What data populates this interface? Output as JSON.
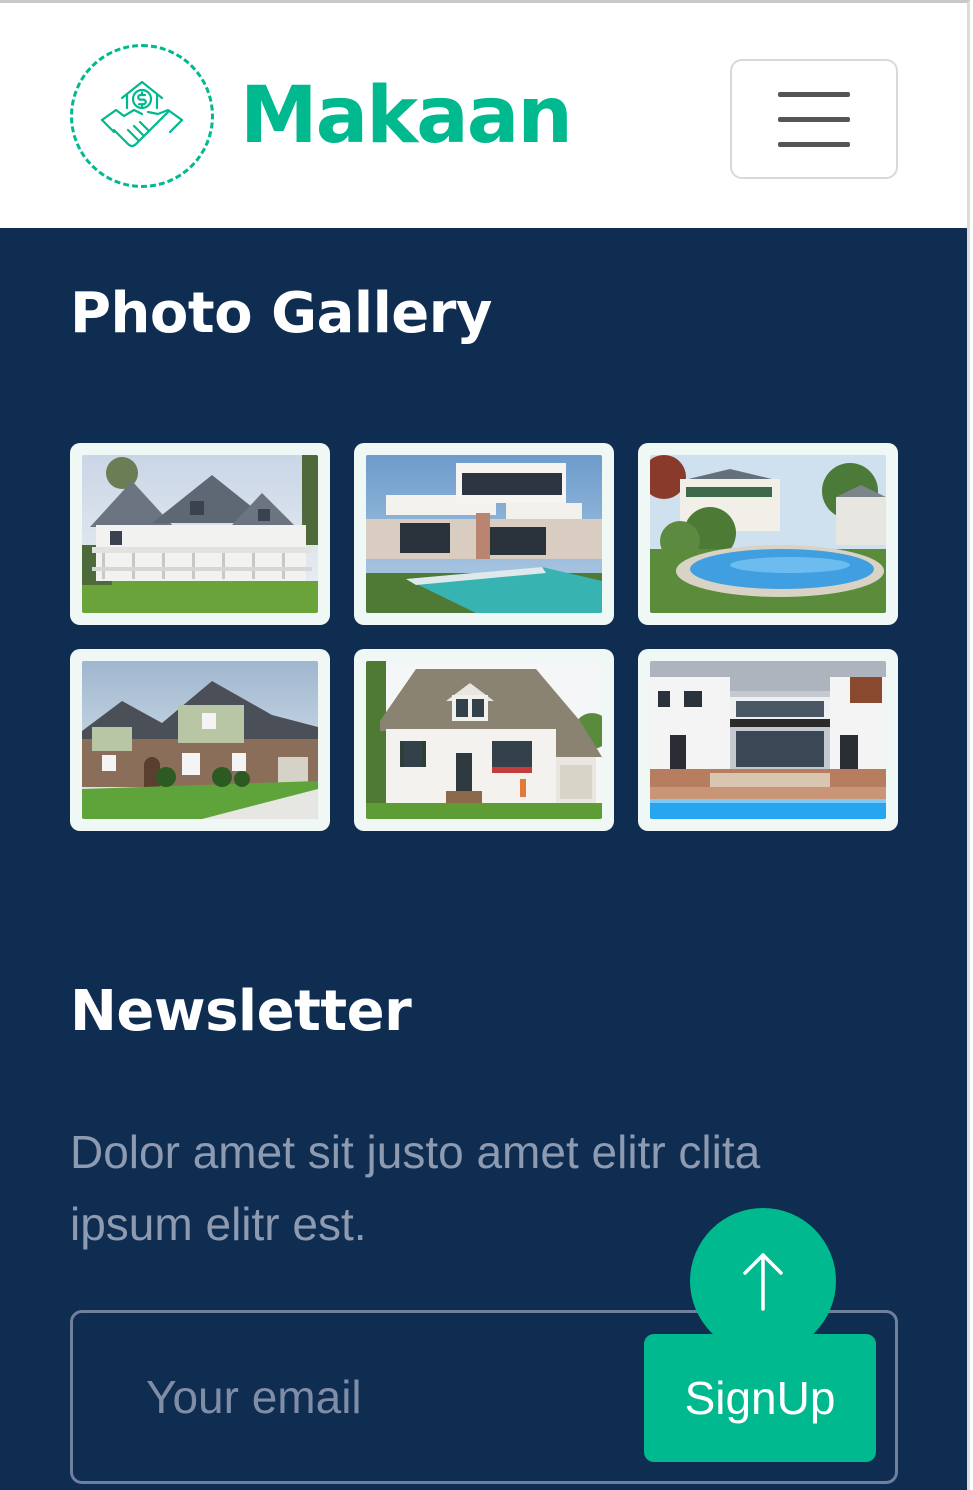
{
  "header": {
    "brand_name": "Makaan",
    "logo_icon": "handshake-dollar-house-icon",
    "menu_icon": "hamburger-menu-icon"
  },
  "gallery": {
    "title": "Photo Gallery",
    "photos": [
      {
        "name": "white-farmhouse-with-porch"
      },
      {
        "name": "modern-villa-with-pool"
      },
      {
        "name": "house-with-backyard-pool"
      },
      {
        "name": "brick-stone-house"
      },
      {
        "name": "white-cottage"
      },
      {
        "name": "modern-house-with-pool"
      }
    ]
  },
  "newsletter": {
    "title": "Newsletter",
    "text": "Dolor amet sit justo amet elitr clita ipsum elitr est.",
    "email_placeholder": "Your email",
    "signup_label": "SignUp"
  },
  "back_to_top": {
    "icon": "arrow-up-icon"
  },
  "colors": {
    "accent": "#00b98e",
    "footer_bg": "#0f2c51",
    "text_muted": "#8d9ab0"
  }
}
